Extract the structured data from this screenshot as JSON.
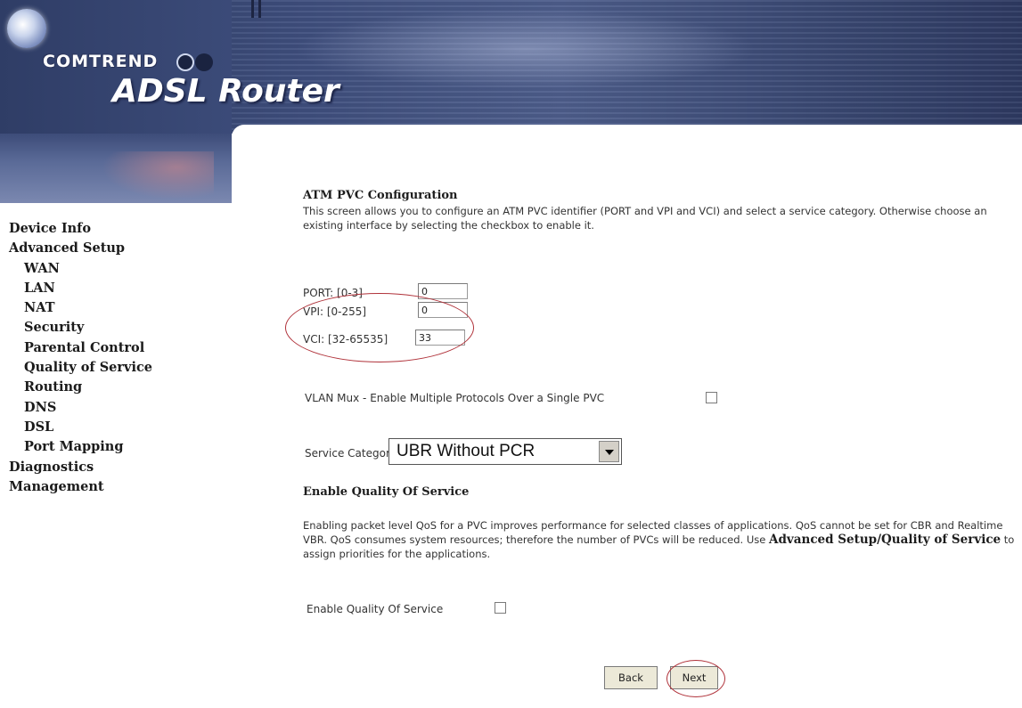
{
  "brand": {
    "company": "COMTREND",
    "product": "ADSL Router"
  },
  "sidebar": {
    "items": [
      {
        "label": "Device Info",
        "level": 0
      },
      {
        "label": "Advanced Setup",
        "level": 0
      },
      {
        "label": "WAN",
        "level": 1
      },
      {
        "label": "LAN",
        "level": 1
      },
      {
        "label": "NAT",
        "level": 1
      },
      {
        "label": "Security",
        "level": 1
      },
      {
        "label": "Parental Control",
        "level": 1
      },
      {
        "label": "Quality of Service",
        "level": 1
      },
      {
        "label": "Routing",
        "level": 1
      },
      {
        "label": "DNS",
        "level": 1
      },
      {
        "label": "DSL",
        "level": 1
      },
      {
        "label": "Port Mapping",
        "level": 1
      },
      {
        "label": "Diagnostics",
        "level": 0
      },
      {
        "label": "Management",
        "level": 0
      }
    ]
  },
  "main": {
    "title": "ATM PVC Configuration",
    "description": "This screen allows you to configure an ATM PVC identifier (PORT and VPI and VCI) and select a service category. Otherwise choose an existing interface by selecting the checkbox to enable it.",
    "port": {
      "label": "PORT: [0-3]",
      "value": "0"
    },
    "vpi": {
      "label": "VPI: [0-255]",
      "value": "0"
    },
    "vci": {
      "label": "VCI: [32-65535]",
      "value": "33"
    },
    "vlan_mux": {
      "label": "VLAN Mux - Enable Multiple Protocols Over a Single PVC",
      "checked": false
    },
    "service_category": {
      "label": "Service Category:",
      "value": "UBR Without PCR"
    },
    "qos": {
      "heading": "Enable Quality Of Service",
      "desc_prefix": "Enabling packet level QoS for a PVC improves performance for selected classes of applications.  QoS cannot be set for CBR and Realtime VBR.  QoS consumes system resources; therefore the number of PVCs will be reduced. Use ",
      "desc_bold": "Advanced Setup/Quality of Service",
      "desc_suffix": " to assign priorities for the applications.",
      "checkbox_label": "Enable Quality Of Service",
      "checked": false
    },
    "buttons": {
      "back": "Back",
      "next": "Next"
    }
  },
  "colors": {
    "annotation_oval": "#b0323a",
    "banner": "#3f4f7e"
  }
}
